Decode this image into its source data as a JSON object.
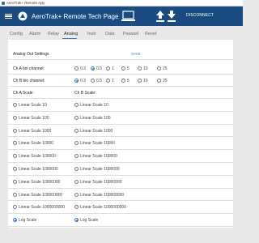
{
  "window": {
    "title": "AeroTrak+ Remote App"
  },
  "header": {
    "title": "AeroTrak+ Remote Tech Page",
    "disconnect_label": "DISCONNECT"
  },
  "tabs": [
    {
      "label": "Config"
    },
    {
      "label": "Alarm"
    },
    {
      "label": "Relay"
    },
    {
      "label": "Analog"
    },
    {
      "label": "Instr"
    },
    {
      "label": "Data"
    },
    {
      "label": "Passwd"
    },
    {
      "label": "Reset"
    }
  ],
  "active_tab": "Analog",
  "panel": {
    "heading": "Analog Out Settings",
    "save_label": "SAVE",
    "ch_a_bin_label": "Ch A bin channel:",
    "ch_b_bin_label": "Ch B bin channel:",
    "bin_options": [
      "0.3",
      "0.5",
      "1",
      "5",
      "10",
      "25"
    ],
    "ch_a_bin_selected": "0.5",
    "ch_b_bin_selected": "0.3",
    "ch_a_scale_label": "Ch A Scale:",
    "ch_b_scale_label": "Ch B Scale:",
    "scale_options": [
      "Linear Scale 10",
      "Linear Scale 100",
      "Linear Scale 1000",
      "Linear Scale 10000",
      "Linear Scale 100000",
      "Linear Scale 1000000",
      "Linear Scale 10000000",
      "Linear Scale 100000000",
      "Linear Scale 1000000000",
      "Log Scale"
    ],
    "ch_a_scale_selected": "Log Scale",
    "ch_b_scale_selected": "Log Scale"
  },
  "colors": {
    "app_bar": "#1a4c82",
    "accent": "#3a78c2",
    "background": "#e9e9e9",
    "panel": "#ffffff"
  }
}
